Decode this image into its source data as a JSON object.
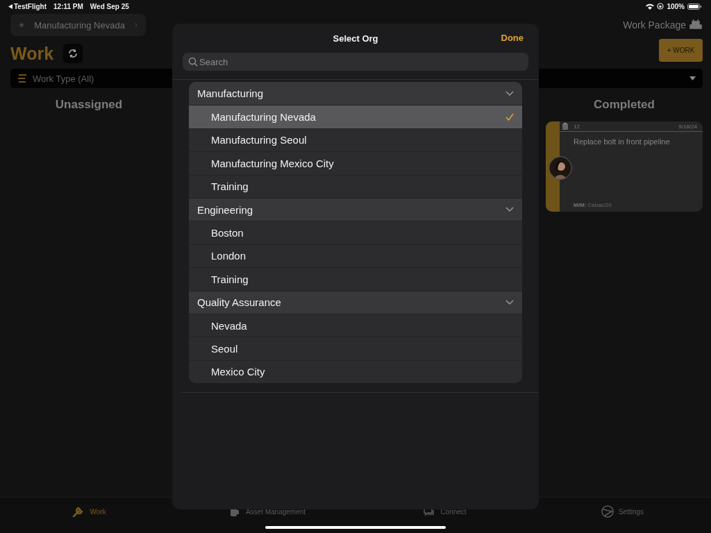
{
  "status_bar": {
    "back_app": "TestFlight",
    "time": "12:11 PM",
    "date": "Wed Sep 25",
    "battery": "100%"
  },
  "header": {
    "org_button": "Manufacturing Nevada",
    "title": "Work",
    "work_package": "Work Package",
    "add_button": "+ WORK",
    "filter": "Work Type (All)"
  },
  "columns": [
    {
      "title": "Unassigned"
    },
    {
      "title": "Completed",
      "cards": [
        {
          "number": "12",
          "date": "9/18/24",
          "description": "Replace bolt in front pipeline",
          "mm_label": "M/M:",
          "mm_value": "Cebac/20"
        }
      ]
    }
  ],
  "tab_bar": [
    {
      "label": "Work",
      "selected": true
    },
    {
      "label": "Asset Management",
      "selected": false
    },
    {
      "label": "Connect",
      "selected": false
    },
    {
      "label": "Settings",
      "selected": false
    }
  ],
  "modal": {
    "title": "Select Org",
    "done": "Done",
    "search": {
      "placeholder": "Search"
    },
    "groups": [
      {
        "label": "Manufacturing",
        "expanded": true,
        "children": [
          {
            "label": "Manufacturing Nevada",
            "selected": true
          },
          {
            "label": "Manufacturing Seoul",
            "selected": false
          },
          {
            "label": "Manufacturing Mexico City",
            "selected": false
          },
          {
            "label": "Training",
            "selected": false
          }
        ]
      },
      {
        "label": "Engineering",
        "expanded": true,
        "children": [
          {
            "label": "Boston",
            "selected": false
          },
          {
            "label": "London",
            "selected": false
          },
          {
            "label": "Training",
            "selected": false
          }
        ]
      },
      {
        "label": "Quality Assurance",
        "expanded": true,
        "children": [
          {
            "label": "Nevada",
            "selected": false
          },
          {
            "label": "Seoul",
            "selected": false
          },
          {
            "label": "Mexico City",
            "selected": false
          }
        ]
      }
    ]
  }
}
